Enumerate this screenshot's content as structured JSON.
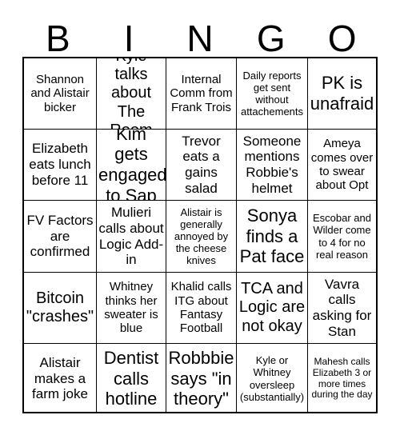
{
  "header": {
    "letters": [
      "B",
      "I",
      "N",
      "G",
      "O"
    ]
  },
  "grid": {
    "rows": [
      [
        {
          "text": "Shannon and Alistair bicker",
          "size": "fs-sm"
        },
        {
          "text": "Kyle talks about The Room",
          "size": "fs-lg"
        },
        {
          "text": "Internal Comm from Frank Trois",
          "size": "fs-sm"
        },
        {
          "text": "Daily reports get sent without attachements",
          "size": "fs-xs"
        },
        {
          "text": "PK is unafraid",
          "size": "fs-xl"
        }
      ],
      [
        {
          "text": "Elizabeth eats lunch before 11",
          "size": "fs-md"
        },
        {
          "text": "Kim gets engaged to Sap",
          "size": "fs-xl"
        },
        {
          "text": "Trevor eats a gains salad",
          "size": "fs-md"
        },
        {
          "text": "Someone mentions Robbie's helmet",
          "size": "fs-md"
        },
        {
          "text": "Ameya comes over to swear about Opt",
          "size": "fs-sm"
        }
      ],
      [
        {
          "text": "FV Factors are confirmed",
          "size": "fs-md"
        },
        {
          "text": "Mulieri calls about Logic Add-in",
          "size": "fs-md"
        },
        {
          "text": "Alistair is generally annoyed by the cheese knives",
          "size": "fs-xs"
        },
        {
          "text": "Sonya finds a Pat face",
          "size": "fs-xl"
        },
        {
          "text": "Escobar and Wilder come to 4 for no real reason",
          "size": "fs-xs"
        }
      ],
      [
        {
          "text": "Bitcoin \"crashes\"",
          "size": "fs-lg"
        },
        {
          "text": "Whitney thinks her sweater is blue",
          "size": "fs-sm"
        },
        {
          "text": "Khalid calls ITG about Fantasy Football",
          "size": "fs-sm"
        },
        {
          "text": "TCA and Logic are not okay",
          "size": "fs-lg"
        },
        {
          "text": "Vavra calls asking for Stan",
          "size": "fs-md"
        }
      ],
      [
        {
          "text": "Alistair makes a farm joke",
          "size": "fs-md"
        },
        {
          "text": "Dentist calls hotline",
          "size": "fs-xl"
        },
        {
          "text": "Robbbie says \"in theory\"",
          "size": "fs-xl"
        },
        {
          "text": "Kyle or Whitney oversleep (substantially)",
          "size": "fs-xs"
        },
        {
          "text": "Mahesh calls Elizabeth 3 or more times during the day",
          "size": "fs-xxs"
        }
      ]
    ]
  }
}
